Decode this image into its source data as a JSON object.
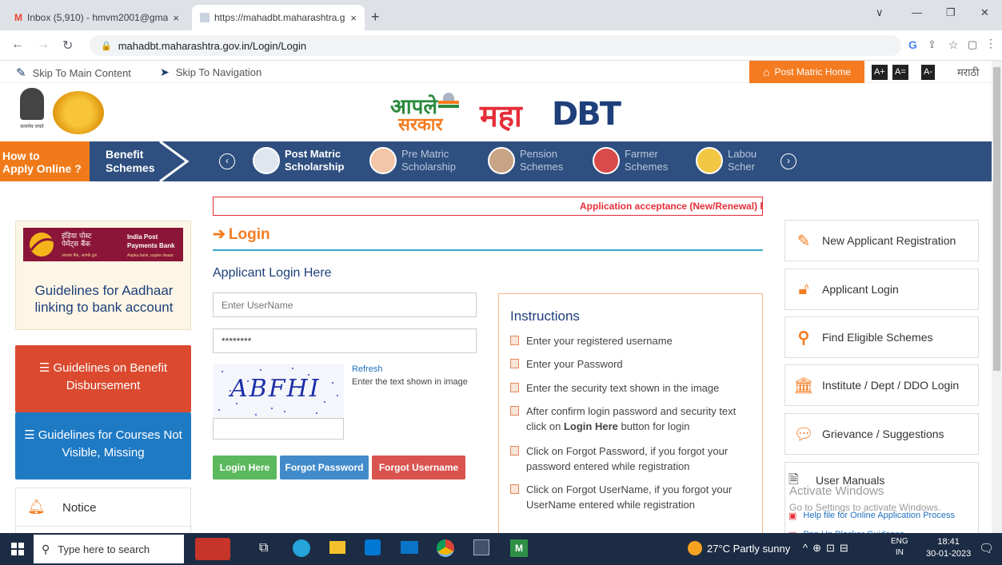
{
  "browser": {
    "tabs": [
      {
        "title": "Inbox (5,910) - hmvm2001@gma",
        "close": "×"
      },
      {
        "title": "https://mahadbt.maharashtra.go",
        "close": "×"
      }
    ],
    "new_tab": "+",
    "url": "mahadbt.maharashtra.gov.in/Login/Login",
    "window_controls": [
      "∨",
      "—",
      "❐",
      "✕"
    ]
  },
  "util": {
    "skip_main": "Skip To Main Content",
    "skip_nav": "Skip To Navigation",
    "post_matric_home": "Post Matric Home",
    "font_buttons": [
      "A+",
      "A=",
      "A-"
    ],
    "language": "मराठी"
  },
  "header": {
    "emblem_caption": "सत्यमेव जयते",
    "logo_line1": "आपले",
    "logo_line2": "सरकार",
    "logo_maha": "महा",
    "logo_dbt": "DBT"
  },
  "nav": {
    "how_to_1": "How to",
    "how_to_2": "Apply Online ?",
    "benefit_1": "Benefit",
    "benefit_2": "Schemes",
    "items": [
      {
        "l1": "Post Matric",
        "l2": "Scholarship"
      },
      {
        "l1": "Pre Matric",
        "l2": "Scholarship"
      },
      {
        "l1": "Pension",
        "l2": "Schemes"
      },
      {
        "l1": "Farmer",
        "l2": "Schemes"
      },
      {
        "l1": "Labou",
        "l2": "Scher"
      }
    ]
  },
  "left": {
    "ippb_hindi_1": "इंडिया पोस्ट",
    "ippb_hindi_2": "पेमेंट्स बैंक",
    "ippb_en_1": "India Post",
    "ippb_en_2": "Payments Bank",
    "ippb_tag_hi": "आपका बैंक, आपके द्वार",
    "ippb_tag_en": "Aapka bank, aapke dwaar",
    "aadhaar_1": "Guidelines for Aadhaar",
    "aadhaar_2": "linking to bank account",
    "benefit_1": "Guidelines on Benefit",
    "benefit_2": "Disbursement",
    "courses_1": "Guidelines for Courses Not",
    "courses_2": "Visible, Missing",
    "notice": "Notice"
  },
  "main": {
    "marquee": "Application acceptance (New/Renewal) has",
    "title": "Login",
    "subtitle": "Applicant Login Here",
    "username_placeholder": "Enter UserName",
    "password_value": "********",
    "captcha_text": "ABFHI",
    "refresh": "Refresh",
    "captcha_hint": "Enter the text shown in image",
    "login_btn": "Login Here",
    "forgot_pw_btn": "Forgot Password",
    "forgot_user_btn": "Forgot Username",
    "colors": {
      "green": "#5cb85c",
      "blue": "#428bca",
      "red": "#d9534f",
      "orange": "#f47b20"
    }
  },
  "instructions": {
    "title": "Instructions",
    "items": [
      "Enter your registered username",
      "Enter your Password",
      "Enter the security text shown in the image",
      "After confirm login password and security text",
      "click on",
      "Login Here",
      "button for login",
      "Click on Forgot Password, if you forgot your",
      "password entered while registration",
      "Click on Forgot UserName, if you forgot your",
      "UserName entered while registration"
    ]
  },
  "right": {
    "items": [
      "New Applicant Registration",
      "Applicant Login",
      "Find Eligible Schemes",
      "Institute / Dept / DDO Login",
      "Grievance / Suggestions",
      "User Manuals"
    ],
    "help_file": "Help file for Online Application Process",
    "popup": "Pop Up Blocker Guidance"
  },
  "watermark": {
    "line1": "Activate Windows",
    "line2": "Go to Settings to activate Windows."
  },
  "taskbar": {
    "search": "Type here to search",
    "weather": "27°C  Partly sunny",
    "lang_1": "ENG",
    "lang_2": "IN",
    "time": "18:41",
    "date": "30-01-2023"
  }
}
